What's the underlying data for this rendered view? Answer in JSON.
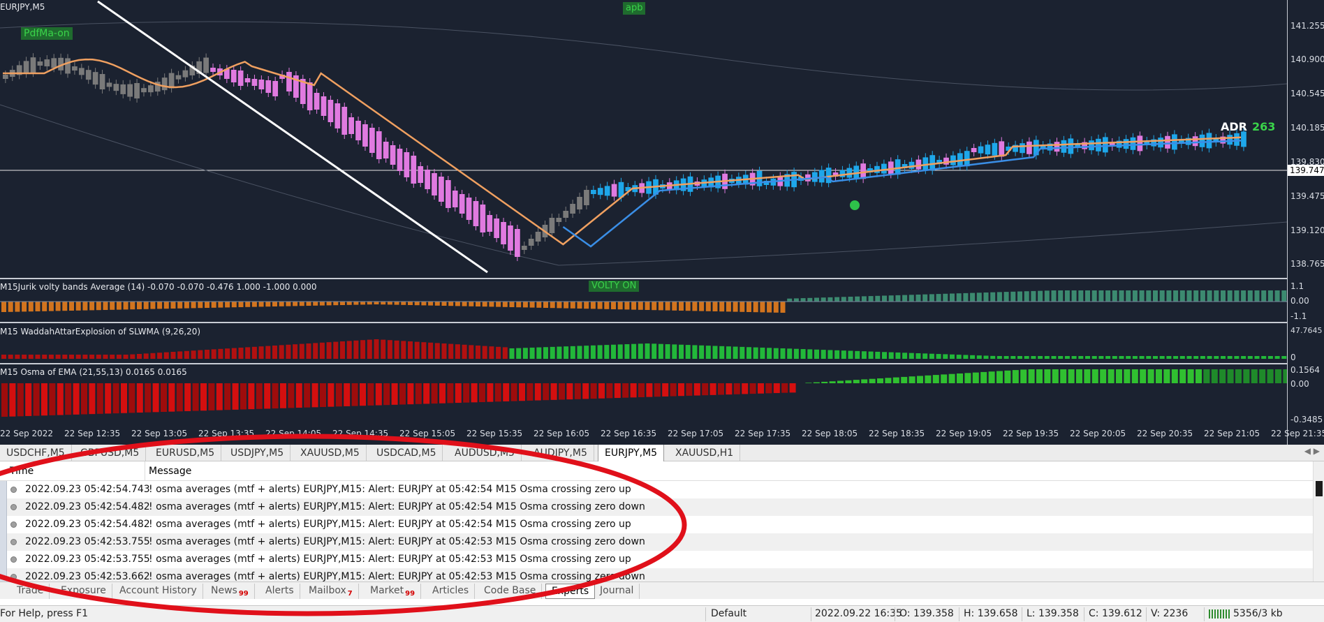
{
  "chart": {
    "symbol_title": "EURJPY,M5",
    "badge_pdfma": "PdfMa-on",
    "badge_apb": "apb",
    "badge_volty": "VOLTY ON",
    "adr_label": "ADR",
    "adr_value": "263",
    "price_scale": [
      "141.255",
      "140.900",
      "140.545",
      "140.185",
      "139.830",
      "139.475",
      "139.120",
      "138.765"
    ],
    "current_price": "139.747",
    "pane1_title": "M15Jurik volty bands Average (14) -0.070 -0.070 -0.476 1.000 -1.000 0.000",
    "pane1_scale": [
      "1.1",
      "0.00",
      "-1.1"
    ],
    "pane2_title": "M15 WaddahAttarExplosion of SLWMA (9,26,20)",
    "pane2_scale": [
      "47.7645",
      "0"
    ],
    "pane3_title": "M15 Osma of EMA (21,55,13) 0.0165 0.0165",
    "pane3_scale": [
      "0.1564",
      "0.00",
      "-0.3485"
    ],
    "time_axis": [
      "22 Sep 2022",
      "22 Sep 12:35",
      "22 Sep 13:05",
      "22 Sep 13:35",
      "22 Sep 14:05",
      "22 Sep 14:35",
      "22 Sep 15:05",
      "22 Sep 15:35",
      "22 Sep 16:05",
      "22 Sep 16:35",
      "22 Sep 17:05",
      "22 Sep 17:35",
      "22 Sep 18:05",
      "22 Sep 18:35",
      "22 Sep 19:05",
      "22 Sep 19:35",
      "22 Sep 20:05",
      "22 Sep 20:35",
      "22 Sep 21:05",
      "22 Sep 21:35"
    ],
    "colors": {
      "background": "#1b2230",
      "bull_candle": "#1ea7ea",
      "bear_candle": "#e07ae0",
      "neutral_candle": "#7a7a7a",
      "ma_orange": "#f0a060",
      "ma_blue": "#3a8ee6",
      "osma_negative": "#e01010",
      "osma_positive": "#30c030"
    }
  },
  "symbol_tabs": [
    "USDCHF,M5",
    "GBPUSD,M5",
    "EURUSD,M5",
    "USDJPY,M5",
    "XAUUSD,M5",
    "USDCAD,M5",
    "AUDUSD,M5",
    "AUDJPY,M5",
    "EURJPY,M5",
    "XAUUSD,H1"
  ],
  "active_symbol_tab": "EURJPY,M5",
  "log": {
    "col_time": "Time",
    "col_message": "Message",
    "rows": [
      {
        "time": "2022.09.23 05:42:54.743",
        "message": "! osma averages (mtf + alerts) EURJPY,M15: Alert: EURJPY at 05:42:54 M15 Osma crossing zero up"
      },
      {
        "time": "2022.09.23 05:42:54.482",
        "message": "! osma averages (mtf + alerts) EURJPY,M15: Alert: EURJPY at 05:42:54 M15 Osma crossing zero down"
      },
      {
        "time": "2022.09.23 05:42:54.482",
        "message": "! osma averages (mtf + alerts) EURJPY,M15: Alert: EURJPY at 05:42:54 M15 Osma crossing zero up"
      },
      {
        "time": "2022.09.23 05:42:53.755",
        "message": "! osma averages (mtf + alerts) EURJPY,M15: Alert: EURJPY at 05:42:53 M15 Osma crossing zero down"
      },
      {
        "time": "2022.09.23 05:42:53.755",
        "message": "! osma averages (mtf + alerts) EURJPY,M15: Alert: EURJPY at 05:42:53 M15 Osma crossing zero up"
      },
      {
        "time": "2022.09.23 05:42:53.662",
        "message": "! osma averages (mtf + alerts) EURJPY,M15: Alert: EURJPY at 05:42:53 M15 Osma crossing zero down"
      }
    ]
  },
  "bottom_tabs": [
    {
      "label": "Trade",
      "count": ""
    },
    {
      "label": "Exposure",
      "count": ""
    },
    {
      "label": "Account History",
      "count": ""
    },
    {
      "label": "News",
      "count": "99"
    },
    {
      "label": "Alerts",
      "count": ""
    },
    {
      "label": "Mailbox",
      "count": "7"
    },
    {
      "label": "Market",
      "count": "99"
    },
    {
      "label": "Articles",
      "count": ""
    },
    {
      "label": "Code Base",
      "count": ""
    },
    {
      "label": "Experts",
      "count": ""
    },
    {
      "label": "Journal",
      "count": ""
    }
  ],
  "status": {
    "help": "For Help, press F1",
    "profile": "Default",
    "datetime": "2022.09.22 16:35",
    "open": "O: 139.358",
    "high": "H: 139.658",
    "low": "L: 139.358",
    "close": "C: 139.612",
    "volume": "V: 2236",
    "traffic": "5356/3 kb"
  },
  "annotation_color": "#e0101a"
}
